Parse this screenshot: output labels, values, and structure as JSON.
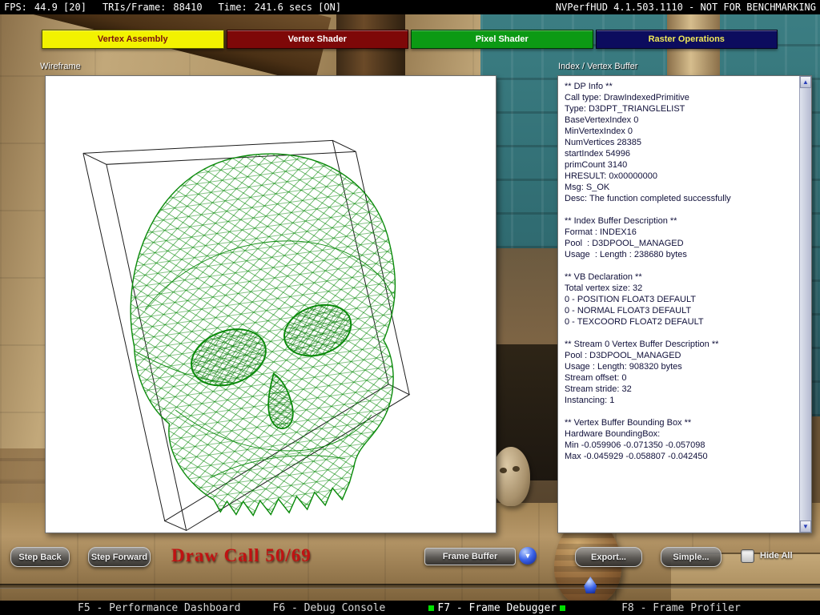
{
  "top_bar": {
    "fps_label": "FPS:",
    "fps_value": "44.9 [20]",
    "tris_label": "TRIs/Frame:",
    "tris_value": "88410",
    "time_label": "Time:",
    "time_value": "241.6 secs [ON]",
    "title": "NVPerfHUD 4.1.503.1110 - NOT FOR BENCHMARKING"
  },
  "pipeline_stages": [
    {
      "label": "Vertex Assembly",
      "color": "#f2f200",
      "text_color": "#7a1010"
    },
    {
      "label": "Vertex Shader",
      "color": "#7e0808",
      "text_color": "#ffffff"
    },
    {
      "label": "Pixel Shader",
      "color": "#0c9a14",
      "text_color": "#ffffff"
    },
    {
      "label": "Raster Operations",
      "color": "#0c0c5e",
      "text_color": "#f0e858"
    }
  ],
  "wireframe_panel": {
    "title": "Wireframe",
    "mesh_color": "#0a8a0a"
  },
  "buffer_panel": {
    "title": "Index / Vertex Buffer",
    "lines": [
      "** DP Info **",
      "Call type: DrawIndexedPrimitive",
      "Type: D3DPT_TRIANGLELIST",
      "BaseVertexIndex 0",
      "MinVertexIndex 0",
      "NumVertices 28385",
      "startIndex 54996",
      "primCount 3140",
      "HRESULT: 0x00000000",
      "Msg: S_OK",
      "Desc: The function completed successfully",
      "",
      "** Index Buffer Description **",
      "Format : INDEX16",
      "Pool  : D3DPOOL_MANAGED",
      "Usage  : Length : 238680 bytes",
      "",
      "** VB Declaration **",
      "Total vertex size: 32",
      "0 - POSITION FLOAT3 DEFAULT",
      "0 - NORMAL FLOAT3 DEFAULT",
      "0 - TEXCOORD FLOAT2 DEFAULT",
      "",
      "** Stream 0 Vertex Buffer Description **",
      "Pool : D3DPOOL_MANAGED",
      "Usage : Length: 908320 bytes",
      "Stream offset: 0",
      "Stream stride: 32",
      "Instancing: 1",
      "",
      "** Vertex Buffer Bounding Box **",
      "Hardware BoundingBox:",
      "Min -0.059906 -0.071350 -0.057098",
      "Max -0.045929 -0.058807 -0.042450"
    ]
  },
  "controls": {
    "step_back_label": "Step Back",
    "step_forward_label": "Step Forward",
    "draw_call_text": "Draw Call 50/69",
    "draw_call_color": "#c01212",
    "frame_buffer_label": "Frame Buffer",
    "export_label": "Export...",
    "simple_label": "Simple...",
    "hide_all_label": "Hide All",
    "hide_all_checked": false,
    "timeline_position_pct": 72
  },
  "icons": {
    "dropdown_arrow": "▼",
    "scroll_up": "▲",
    "scroll_down": "▼"
  },
  "status_bar": {
    "items": [
      {
        "label": "F5 - Performance Dashboard",
        "active": false
      },
      {
        "label": "F6 - Debug Console",
        "active": false
      },
      {
        "label": "F7 - Frame Debugger",
        "active": true
      },
      {
        "label": "F8 - Frame Profiler",
        "active": false
      }
    ],
    "active_indicator_color": "#00e000"
  }
}
